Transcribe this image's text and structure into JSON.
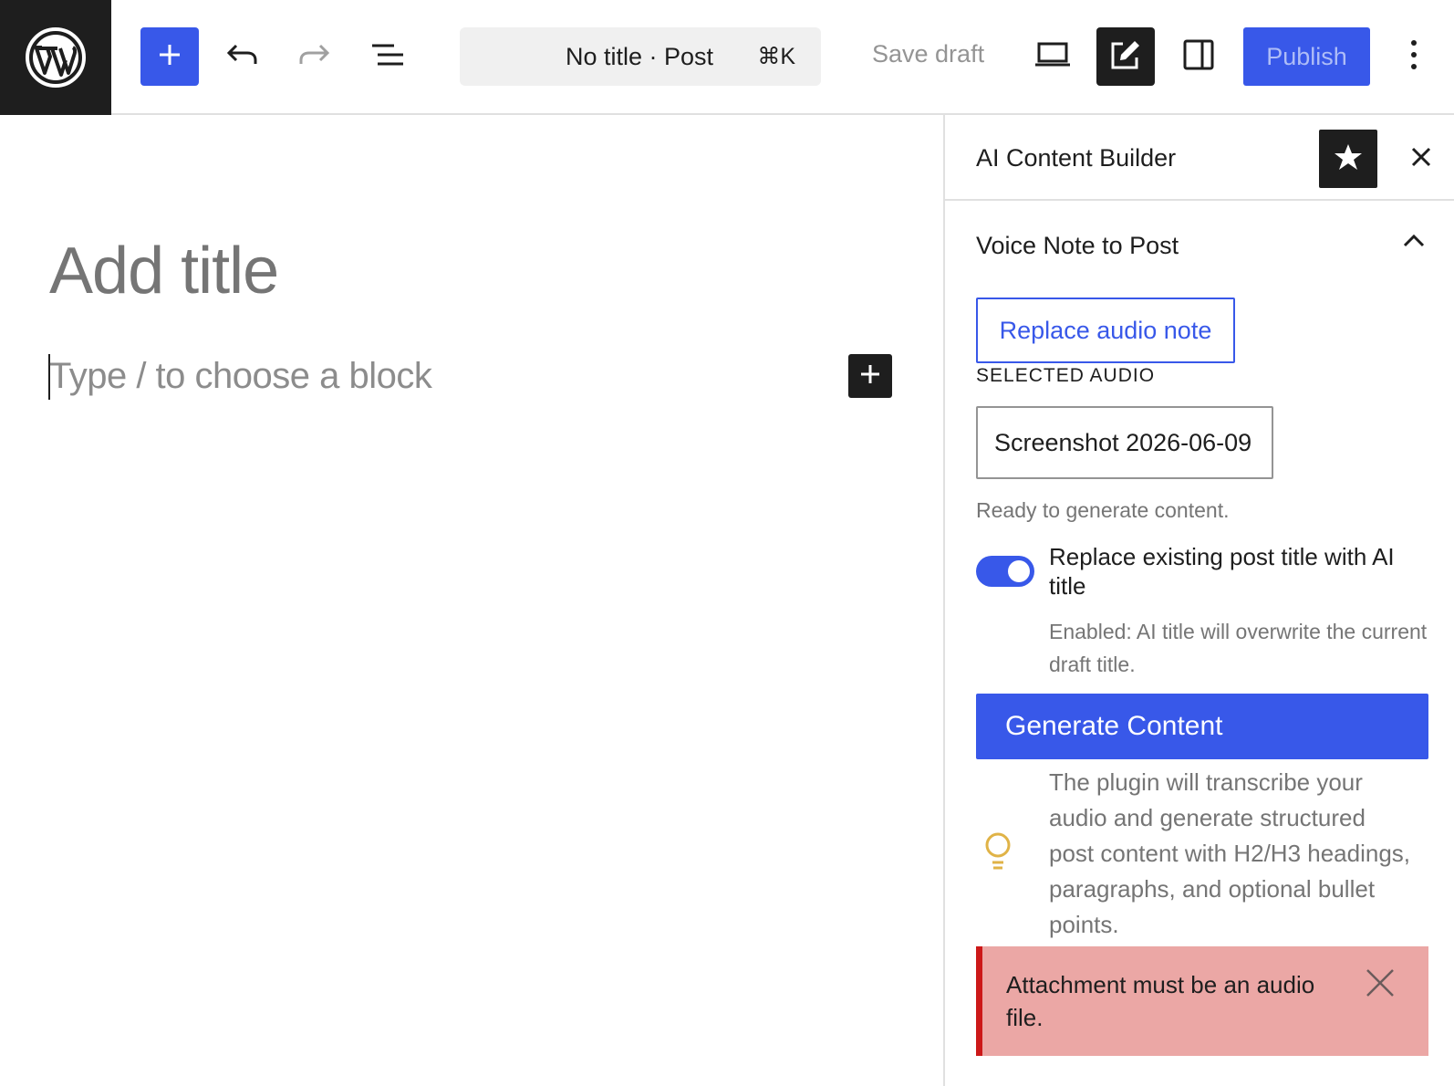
{
  "topbar": {
    "logo_icon": "wordpress-logo-icon",
    "add_block_icon": "plus-icon",
    "undo_icon": "undo-icon",
    "redo_icon": "redo-icon",
    "list_view_icon": "list-view-icon",
    "command_title": "No title · Post",
    "command_shortcut": "⌘K",
    "save_draft_label": "Save draft",
    "preview_icon": "laptop-icon",
    "plugin_icon": "edit-post-icon",
    "settings_icon": "sidebar-toggle-icon",
    "publish_label": "Publish",
    "more_icon": "more-vertical-icon"
  },
  "editor": {
    "title_placeholder": "Add title",
    "block_placeholder": "Type / to choose a block",
    "inserter_icon": "plus-icon"
  },
  "sidebar": {
    "title": "AI Content Builder",
    "star_icon": "star-icon",
    "close_icon": "close-icon",
    "panel": {
      "title": "Voice Note to Post",
      "toggle_icon": "chevron-up-icon",
      "replace_audio_label": "Replace audio note",
      "selected_audio_label": "SELECTED AUDIO",
      "selected_audio_value": "Screenshot 2026-06-09",
      "status_text": "Ready to generate content.",
      "replace_title_toggle": {
        "label": "Replace existing post title with AI title",
        "checked": true,
        "help": "Enabled: AI title will overwrite the current draft title."
      },
      "generate_label": "Generate Content",
      "tip_icon": "lightbulb-icon",
      "tip_text": "The plugin will transcribe your audio and generate structured post content with H2/H3 headings, paragraphs, and optional bullet points.",
      "error_notice": {
        "text": "Attachment must be an audio file.",
        "close_icon": "close-icon"
      }
    }
  },
  "colors": {
    "accent": "#3858e9",
    "dark": "#1e1e1e",
    "error_bg": "#eba7a5",
    "error_border": "#cc1818",
    "tip_icon": "#e0b347"
  }
}
